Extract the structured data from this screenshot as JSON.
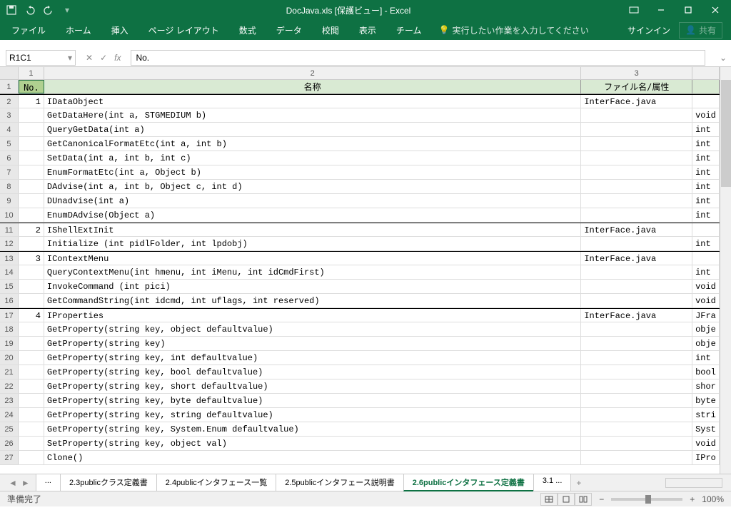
{
  "title": "DocJava.xls [保護ビュー] - Excel",
  "qat": {
    "save": "save",
    "undo": "undo",
    "redo": "redo"
  },
  "ribbon": {
    "tabs": [
      "ファイル",
      "ホーム",
      "挿入",
      "ページ レイアウト",
      "数式",
      "データ",
      "校閲",
      "表示",
      "チーム"
    ],
    "tellme": "実行したい作業を入力してください",
    "signin": "サインイン",
    "share": "共有"
  },
  "namebox": "R1C1",
  "fx_value": "No.",
  "col_headers": [
    "1",
    "2",
    "3",
    ""
  ],
  "header_cells": [
    "No.",
    "名称",
    "ファイル名/属性",
    ""
  ],
  "rows": [
    {
      "r": "2",
      "no": "1",
      "name": "IDataObject",
      "file": "InterFace.java",
      "attr": "",
      "sep": true
    },
    {
      "r": "3",
      "no": "",
      "name": "GetDataHere(int a, STGMEDIUM b)",
      "file": "",
      "attr": "void"
    },
    {
      "r": "4",
      "no": "",
      "name": "QueryGetData(int a)",
      "file": "",
      "attr": "int"
    },
    {
      "r": "5",
      "no": "",
      "name": "GetCanonicalFormatEtc(int a, int b)",
      "file": "",
      "attr": "int"
    },
    {
      "r": "6",
      "no": "",
      "name": "SetData(int a, int b, int c)",
      "file": "",
      "attr": "int"
    },
    {
      "r": "7",
      "no": "",
      "name": "EnumFormatEtc(int a, Object b)",
      "file": "",
      "attr": "int"
    },
    {
      "r": "8",
      "no": "",
      "name": "DAdvise(int a, int b, Object c, int d)",
      "file": "",
      "attr": "int"
    },
    {
      "r": "9",
      "no": "",
      "name": "DUnadvise(int a)",
      "file": "",
      "attr": "int"
    },
    {
      "r": "10",
      "no": "",
      "name": "EnumDAdvise(Object a)",
      "file": "",
      "attr": "int"
    },
    {
      "r": "11",
      "no": "2",
      "name": "IShellExtInit",
      "file": "InterFace.java",
      "attr": "",
      "sep": true
    },
    {
      "r": "12",
      "no": "",
      "name": "Initialize (int pidlFolder, int lpdobj)",
      "file": "",
      "attr": "int"
    },
    {
      "r": "13",
      "no": "3",
      "name": "IContextMenu",
      "file": "InterFace.java",
      "attr": "",
      "sep": true
    },
    {
      "r": "14",
      "no": "",
      "name": "QueryContextMenu(int hmenu, int iMenu, int idCmdFirst)",
      "file": "",
      "attr": "int"
    },
    {
      "r": "15",
      "no": "",
      "name": "InvokeCommand (int pici)",
      "file": "",
      "attr": "void"
    },
    {
      "r": "16",
      "no": "",
      "name": "GetCommandString(int idcmd, int uflags, int reserved)",
      "file": "",
      "attr": "void"
    },
    {
      "r": "17",
      "no": "4",
      "name": "IProperties",
      "file": "InterFace.java",
      "attr": "JFra",
      "sep": true
    },
    {
      "r": "18",
      "no": "",
      "name": "GetProperty(string key, object defaultvalue)",
      "file": "",
      "attr": "obje"
    },
    {
      "r": "19",
      "no": "",
      "name": "GetProperty(string key)",
      "file": "",
      "attr": "obje"
    },
    {
      "r": "20",
      "no": "",
      "name": "GetProperty(string key, int defaultvalue)",
      "file": "",
      "attr": "int"
    },
    {
      "r": "21",
      "no": "",
      "name": "GetProperty(string key, bool defaultvalue)",
      "file": "",
      "attr": "bool"
    },
    {
      "r": "22",
      "no": "",
      "name": "GetProperty(string key, short defaultvalue)",
      "file": "",
      "attr": "shor"
    },
    {
      "r": "23",
      "no": "",
      "name": "GetProperty(string key, byte defaultvalue)",
      "file": "",
      "attr": "byte"
    },
    {
      "r": "24",
      "no": "",
      "name": "GetProperty(string key, string defaultvalue)",
      "file": "",
      "attr": "stri"
    },
    {
      "r": "25",
      "no": "",
      "name": "GetProperty(string key, System.Enum defaultvalue)",
      "file": "",
      "attr": "Syst"
    },
    {
      "r": "26",
      "no": "",
      "name": "SetProperty(string key, object val)",
      "file": "",
      "attr": "void"
    },
    {
      "r": "27",
      "no": "",
      "name": "Clone()",
      "file": "",
      "attr": "IPro"
    }
  ],
  "sheets": {
    "items": [
      "...",
      "2.3publicクラス定義書",
      "2.4publicインタフェース一覧",
      "2.5publicインタフェース説明書",
      "2.6publicインタフェース定義書",
      "3.1 ..."
    ],
    "active": 4,
    "add": "+"
  },
  "status": {
    "ready": "準備完了",
    "zoom": "100%",
    "minus": "−",
    "plus": "+"
  }
}
